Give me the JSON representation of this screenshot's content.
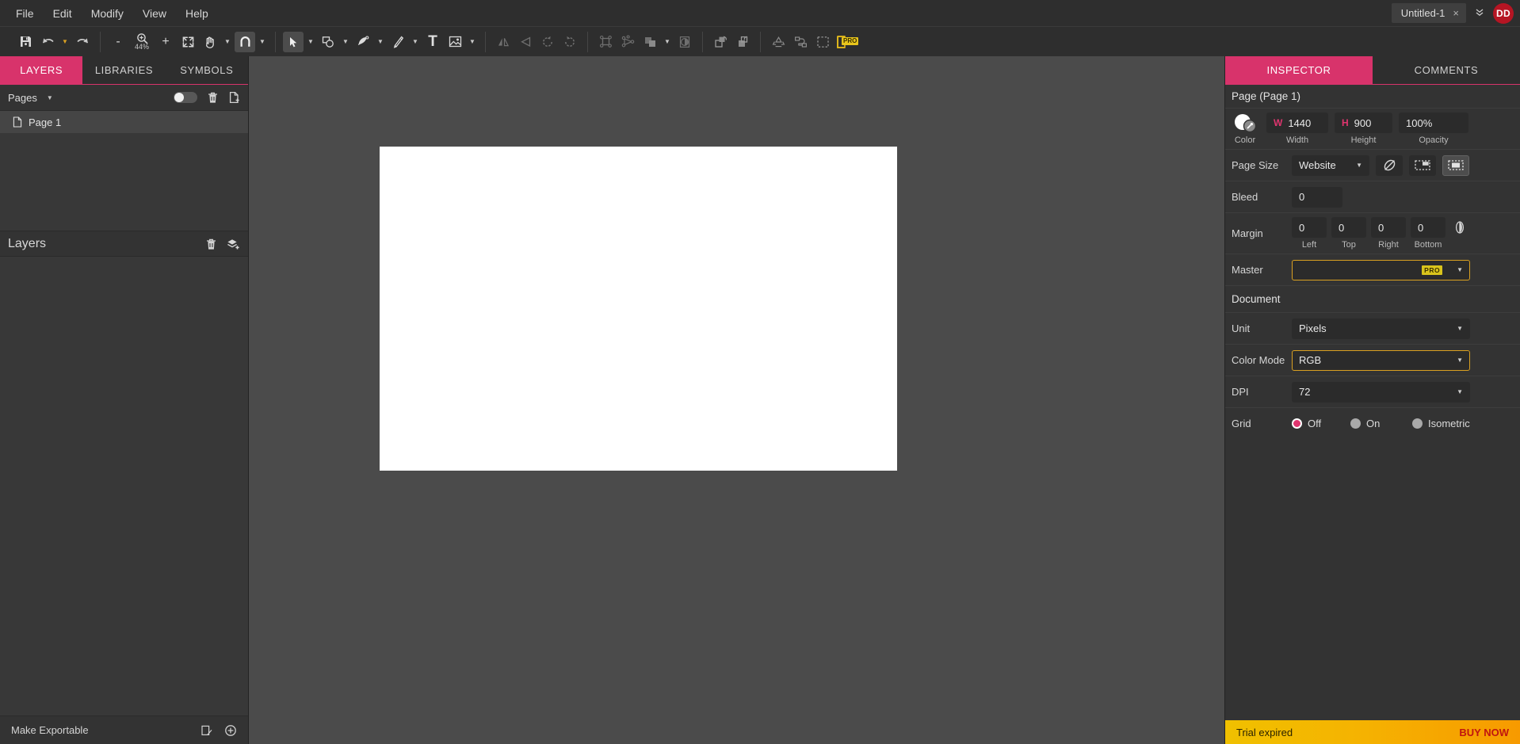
{
  "menubar": {
    "items": [
      {
        "label": "File"
      },
      {
        "label": "Edit"
      },
      {
        "label": "Modify"
      },
      {
        "label": "View"
      },
      {
        "label": "Help"
      }
    ],
    "document_tab": "Untitled-1",
    "close_glyph": "×",
    "chevron_glyph": "ˇ",
    "avatar_initials": "DD"
  },
  "toolbar": {
    "zoom_level": "44%",
    "minus": "-",
    "plus": "+",
    "pro_badge": "PRO",
    "icons": [
      {
        "name": "save-icon"
      },
      {
        "name": "undo-icon"
      },
      {
        "name": "redo-icon"
      },
      {
        "name": "zoom-out-icon"
      },
      {
        "name": "zoom-level-icon"
      },
      {
        "name": "zoom-in-icon"
      },
      {
        "name": "fit-screen-icon"
      },
      {
        "name": "hand-tool-icon"
      },
      {
        "name": "magnet-snap-icon"
      },
      {
        "name": "select-arrow-icon"
      },
      {
        "name": "shape-tool-icon"
      },
      {
        "name": "pen-tool-icon"
      },
      {
        "name": "pencil-tool-icon"
      },
      {
        "name": "text-tool-icon"
      },
      {
        "name": "image-tool-icon"
      },
      {
        "name": "flip-horizontal-icon"
      },
      {
        "name": "flip-vertical-icon"
      },
      {
        "name": "rotate-left-icon"
      },
      {
        "name": "rotate-right-icon"
      },
      {
        "name": "group-icon"
      },
      {
        "name": "ungroup-icon"
      },
      {
        "name": "boolean-union-icon"
      },
      {
        "name": "mask-icon"
      },
      {
        "name": "bring-forward-icon"
      },
      {
        "name": "send-backward-icon"
      },
      {
        "name": "repeat-icon"
      },
      {
        "name": "connector-icon"
      },
      {
        "name": "selection-frame-icon"
      },
      {
        "name": "export-pro-icon"
      }
    ],
    "text_tool_label": "T"
  },
  "left_panel": {
    "tabs": [
      {
        "label": "LAYERS",
        "active": true
      },
      {
        "label": "LIBRARIES",
        "active": false
      },
      {
        "label": "SYMBOLS",
        "active": false
      }
    ],
    "pages_header": "Pages",
    "page_items": [
      {
        "label": "Page 1"
      }
    ],
    "layers_header": "Layers",
    "footer_label": "Make Exportable"
  },
  "right_panel": {
    "tabs": [
      {
        "label": "INSPECTOR",
        "active": true
      },
      {
        "label": "COMMENTS",
        "active": false
      }
    ],
    "section_title": "Page (Page 1)",
    "color_label": "Color",
    "width": {
      "key": "W",
      "value": "1440",
      "label": "Width"
    },
    "height": {
      "key": "H",
      "value": "900",
      "label": "Height"
    },
    "opacity": {
      "value": "100%",
      "label": "Opacity"
    },
    "page_size": {
      "label": "Page Size",
      "value": "Website"
    },
    "bleed": {
      "label": "Bleed",
      "value": "0"
    },
    "margin": {
      "label": "Margin",
      "left": {
        "value": "0",
        "label": "Left"
      },
      "top": {
        "value": "0",
        "label": "Top"
      },
      "right": {
        "value": "0",
        "label": "Right"
      },
      "bottom": {
        "value": "0",
        "label": "Bottom"
      }
    },
    "master": {
      "label": "Master",
      "value": "",
      "badge": "PRO"
    },
    "document_title": "Document",
    "unit": {
      "label": "Unit",
      "value": "Pixels"
    },
    "color_mode": {
      "label": "Color Mode",
      "value": "RGB"
    },
    "dpi": {
      "label": "DPI",
      "value": "72"
    },
    "grid": {
      "label": "Grid",
      "options": [
        {
          "label": "Off",
          "selected": true
        },
        {
          "label": "On",
          "selected": false
        },
        {
          "label": "Isometric",
          "selected": false
        }
      ]
    }
  },
  "trial_bar": {
    "message": "Trial expired",
    "cta": "BUY NOW"
  },
  "colors": {
    "accent_pink": "#d8336b",
    "accent_gold": "#d9a021",
    "avatar_red": "#b51523",
    "canvas_bg": "#4b4b4b",
    "page_white": "#ffffff",
    "trial_yellow": "#f5b301",
    "buy_now_red": "#c0150f"
  }
}
